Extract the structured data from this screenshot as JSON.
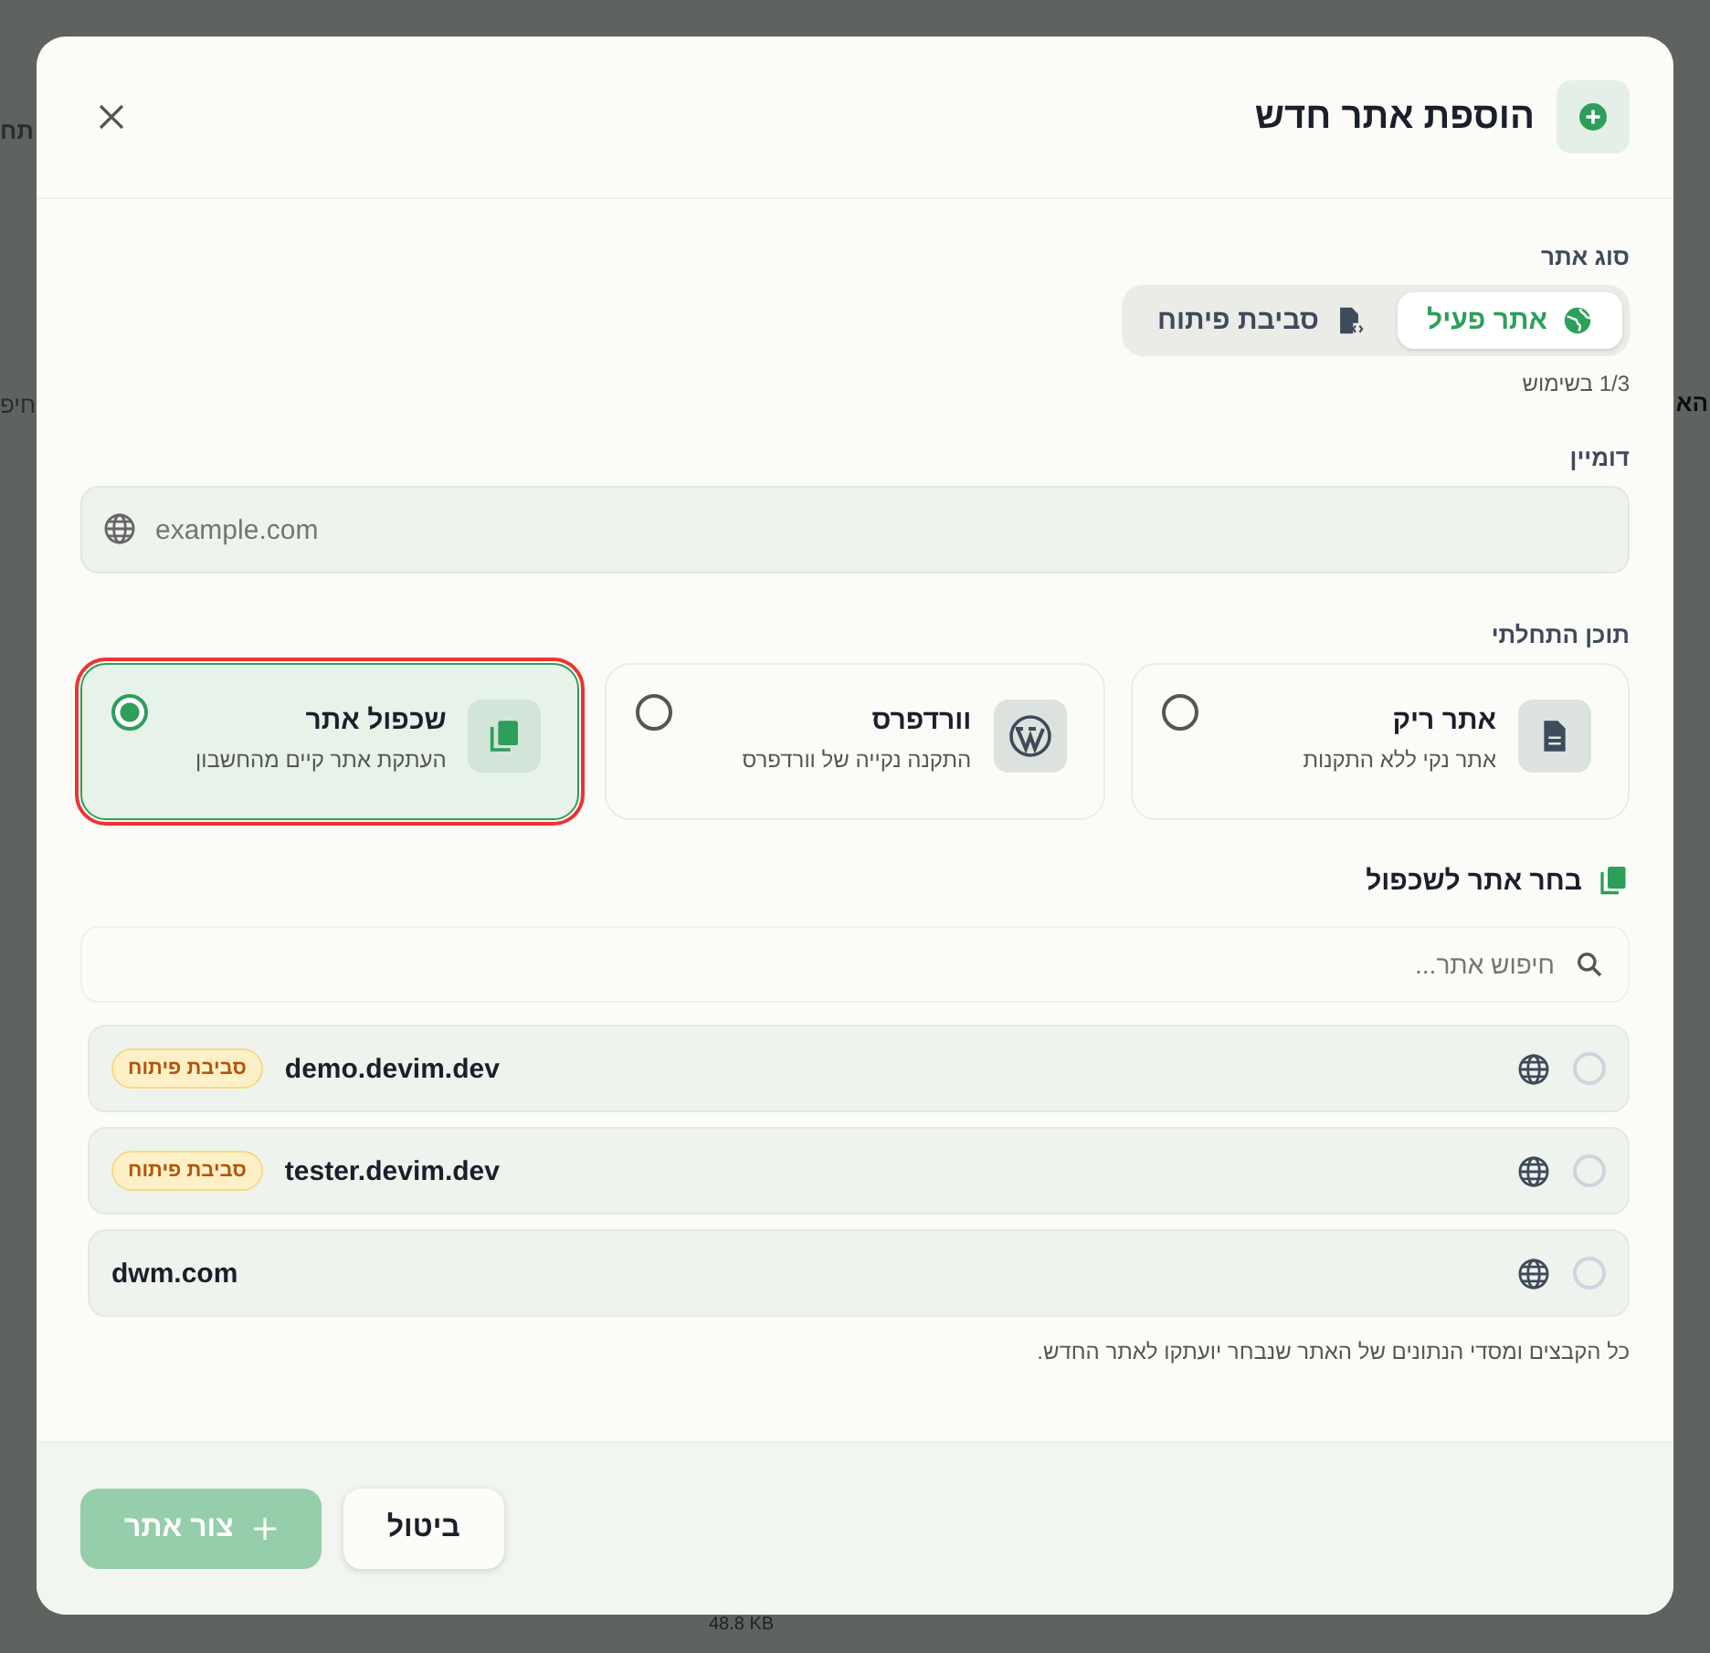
{
  "backdrop": {
    "texts": [
      "תח",
      "הא",
      "חיפ",
      "48.8 KB"
    ]
  },
  "dialog": {
    "title": "הוספת אתר חדש"
  },
  "site_type": {
    "label": "סוג אתר",
    "usage": "1/3 בשימוש",
    "options": [
      {
        "label": "אתר פעיל",
        "kind": "live",
        "selected": true
      },
      {
        "label": "סביבת פיתוח",
        "kind": "dev",
        "selected": false
      }
    ]
  },
  "domain": {
    "label": "דומיין",
    "placeholder": "example.com"
  },
  "starter": {
    "label": "תוכן התחלתי",
    "options": [
      {
        "title": "אתר ריק",
        "description": "אתר נקי ללא התקנות",
        "kind": "blank",
        "selected": false,
        "highlighted": false
      },
      {
        "title": "וורדפרס",
        "description": "התקנה נקייה של וורדפרס",
        "kind": "wordpress",
        "selected": false,
        "highlighted": false
      },
      {
        "title": "שכפול אתר",
        "description": "העתקת אתר קיים מהחשבון",
        "kind": "clone",
        "selected": true,
        "highlighted": true
      }
    ]
  },
  "clone": {
    "title": "בחר אתר לשכפול",
    "search_placeholder": "חיפוש אתר...",
    "note": "כל הקבצים ומסדי הנתונים של האתר שנבחר יועתקו לאתר החדש.",
    "sites": [
      {
        "domain": "demo.devim.dev",
        "badge": "סביבת פיתוח",
        "selected": false
      },
      {
        "domain": "tester.devim.dev",
        "badge": "סביבת פיתוח",
        "selected": false
      },
      {
        "domain": "dwm.com",
        "selected": false
      }
    ]
  },
  "buttons": [
    {
      "label": "ביטול",
      "kind": "cancel",
      "disabled": false
    },
    {
      "label": "צור אתר",
      "kind": "create",
      "disabled": true
    }
  ]
}
